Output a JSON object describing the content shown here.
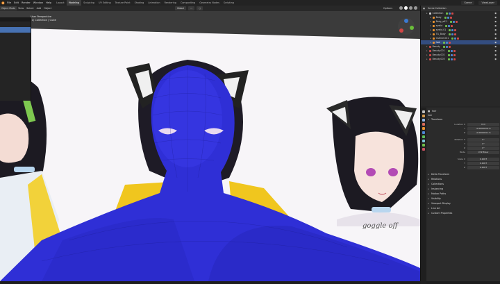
{
  "menu": {
    "items": [
      "File",
      "Edit",
      "Render",
      "Window",
      "Help"
    ],
    "workspaces": [
      "Layout",
      "Modeling",
      "Sculpting",
      "UV Editing",
      "Texture Paint",
      "Shading",
      "Animation",
      "Rendering",
      "Compositing",
      "Geometry Nodes",
      "Scripting"
    ],
    "active_workspace_index": 1,
    "scene_name": "Scene",
    "view_layer": "ViewLayer"
  },
  "viewport_header": {
    "mode": "Object Mode",
    "menus": [
      "View",
      "Select",
      "Add",
      "Object"
    ],
    "transform": "Global",
    "options": "Options"
  },
  "viewport": {
    "info_line1": "User Perspective",
    "info_line2": "(1) Collection | Cube",
    "sketch_text": "goggle off"
  },
  "side_menu": {
    "header": "",
    "items": [
      "",
      "",
      "",
      "",
      "",
      "",
      "",
      "",
      "",
      "",
      "",
      "",
      ""
    ],
    "highlight_index": 1
  },
  "outliner": {
    "header": "Scene Collection",
    "rows": [
      {
        "label": "Collection",
        "indent": 1,
        "color": "white",
        "selected": false
      },
      {
        "label": "Body",
        "indent": 2,
        "color": "orange",
        "selected": false
      },
      {
        "label": "Body_eff.1",
        "indent": 2,
        "color": "orange",
        "selected": false
      },
      {
        "label": "eyelid",
        "indent": 2,
        "color": "orange",
        "selected": false
      },
      {
        "label": "eyelid.01",
        "indent": 2,
        "color": "orange",
        "selected": false
      },
      {
        "label": "TG_Body",
        "indent": 2,
        "color": "orange",
        "selected": false
      },
      {
        "label": "Outline.001",
        "indent": 2,
        "color": "orange",
        "selected": false
      },
      {
        "label": "hair",
        "indent": 2,
        "color": "orange",
        "selected": true
      },
      {
        "label": "Beauty",
        "indent": 1,
        "color": "red",
        "selected": false
      },
      {
        "label": "Beauty.001",
        "indent": 1,
        "color": "red",
        "selected": false
      },
      {
        "label": "Beauty.002",
        "indent": 1,
        "color": "red",
        "selected": false
      },
      {
        "label": "Beauty.003",
        "indent": 1,
        "color": "red",
        "selected": false
      }
    ]
  },
  "properties": {
    "object_name": "hair",
    "sub_name": "hair",
    "transform_label": "Transform",
    "location": {
      "label": "Location X",
      "x": "0 m",
      "y": "-0.0000036 m",
      "z": "-0.0000041 m"
    },
    "rotation": {
      "label": "Rotation X",
      "x": "0°",
      "y": "0°",
      "z": "0°"
    },
    "mode": {
      "label": "Mode",
      "value": "XYZ Euler"
    },
    "scale": {
      "label": "Scale X",
      "x": "0.1007",
      "y": "0.1007",
      "z": "0.1007"
    },
    "sections": [
      "Delta Transform",
      "Relations",
      "Collections",
      "Instancing",
      "Motion Paths",
      "Visibility",
      "Viewport Display",
      "Line Art",
      "Custom Properties"
    ]
  }
}
